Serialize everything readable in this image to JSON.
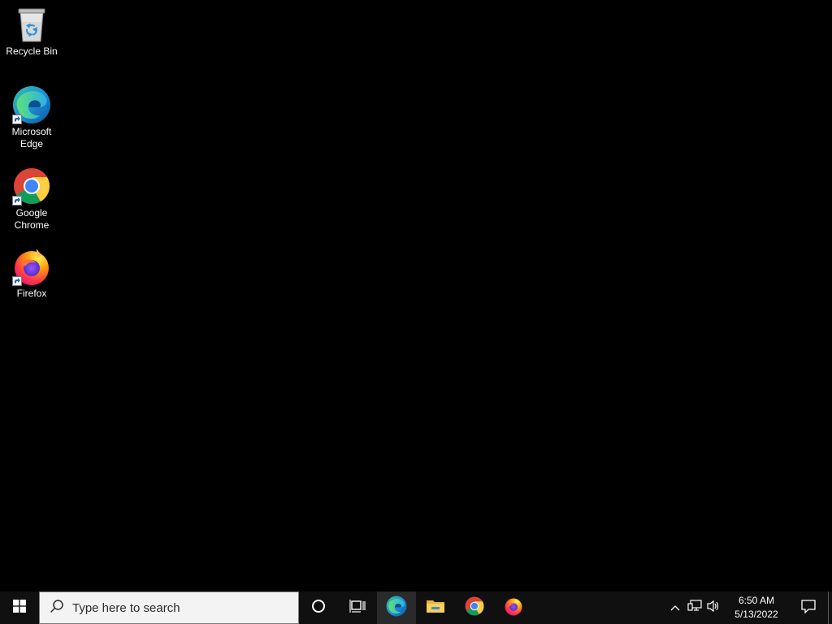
{
  "desktop": {
    "background": "#000000",
    "icons": [
      {
        "name": "recycle-bin",
        "label": "Recycle Bin",
        "icon": "recycle-bin-icon",
        "shortcut": false
      },
      {
        "name": "microsoft-edge",
        "label": "Microsoft\nEdge",
        "icon": "edge-icon",
        "shortcut": true
      },
      {
        "name": "google-chrome",
        "label": "Google\nChrome",
        "icon": "chrome-icon",
        "shortcut": true
      },
      {
        "name": "firefox",
        "label": "Firefox",
        "icon": "firefox-icon",
        "shortcut": true
      }
    ]
  },
  "taskbar": {
    "background": "#101010",
    "start_icon": "windows-logo-icon",
    "search": {
      "placeholder": "Type here to search",
      "icon": "search-icon"
    },
    "cortana_icon": "cortana-icon",
    "task_view_icon": "task-view-icon",
    "pinned_apps": [
      {
        "name": "edge",
        "icon": "edge-icon",
        "active": true
      },
      {
        "name": "file-explorer",
        "icon": "folder-icon",
        "active": false
      },
      {
        "name": "chrome",
        "icon": "chrome-icon",
        "active": false
      },
      {
        "name": "firefox",
        "icon": "firefox-icon",
        "active": false
      }
    ],
    "tray": {
      "icons": [
        "chevron-up-icon",
        "network-icon",
        "volume-icon"
      ],
      "time": "6:50 AM",
      "date": "5/13/2022",
      "notification_icon": "notification-icon"
    }
  }
}
